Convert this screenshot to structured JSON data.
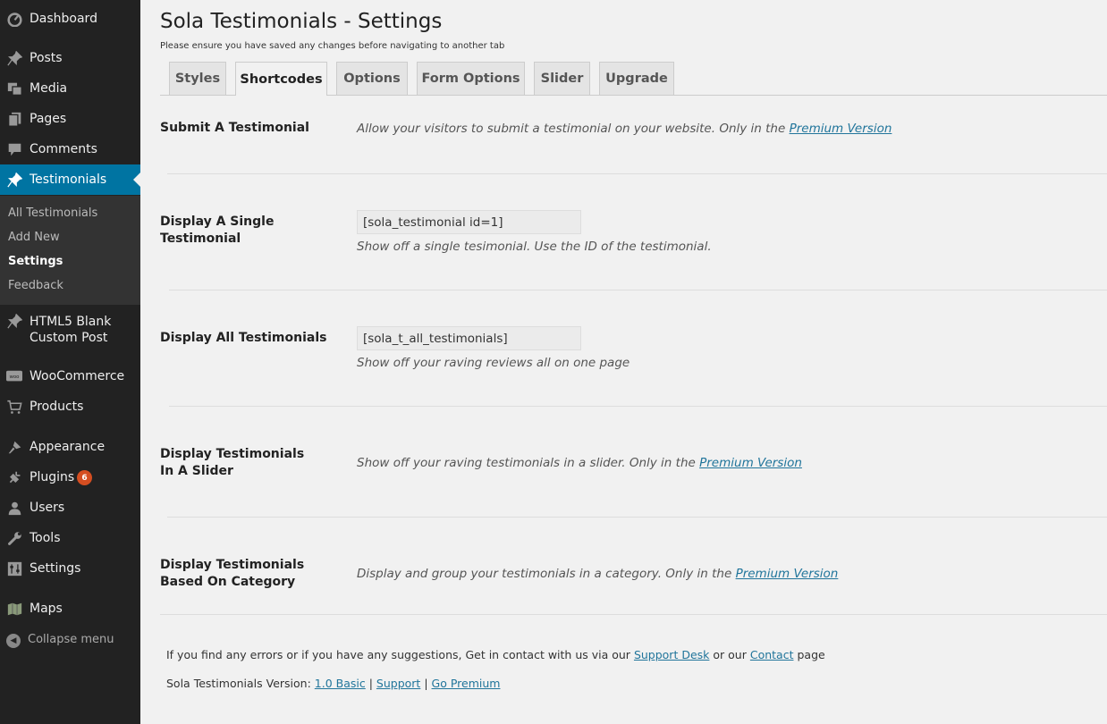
{
  "sidebar": {
    "dashboard": "Dashboard",
    "posts": "Posts",
    "media": "Media",
    "pages": "Pages",
    "comments": "Comments",
    "testimonials": "Testimonials",
    "submenu": [
      "All Testimonials",
      "Add New",
      "Settings",
      "Feedback"
    ],
    "html5_line1": "HTML5 Blank",
    "html5_line2": "Custom Post",
    "woocommerce": "WooCommerce",
    "products": "Products",
    "appearance": "Appearance",
    "plugins": "Plugins",
    "plugins_badge": "6",
    "users": "Users",
    "tools": "Tools",
    "settings": "Settings",
    "maps": "Maps",
    "collapse": "Collapse menu"
  },
  "header": {
    "title": "Sola Testimonials - Settings",
    "notice": "Please ensure you have saved any changes before navigating to another tab"
  },
  "tabs": [
    "Styles",
    "Shortcodes",
    "Options",
    "Form Options",
    "Slider",
    "Upgrade"
  ],
  "active_tab": "Shortcodes",
  "rows": {
    "submit_label": "Submit A Testimonial",
    "submit_desc": "Allow your visitors to submit a testimonial on your website. Only in the",
    "submit_link": "Premium Version",
    "single_label": "Display A Single Testimonial",
    "single_value": "[sola_testimonial id=1]",
    "single_desc": "Show off a single tesimonial. Use the ID of the testimonial.",
    "all_label": "Display All Testimonials",
    "all_value": "[sola_t_all_testimonials]",
    "all_desc": "Show off your raving reviews all on one page",
    "slider_label": "Display Testimonials In A Slider",
    "slider_desc": "Show off your raving testimonials in a slider. Only in the",
    "slider_link": "Premium Version",
    "category_label": "Display Testimonials Based On Category",
    "category_desc": "Display and group your testimonials in a category. Only in the",
    "category_link": "Premium Version"
  },
  "footer": {
    "line1_a": "If you find any errors or if you have any suggestions, Get in contact with us via our",
    "support_desk": "Support Desk",
    "line1_b": "or our",
    "contact": "Contact",
    "line1_c": "page",
    "version_text": "Sola Testimonials Version:",
    "version_link": "1.0 Basic",
    "support": "Support",
    "go_premium": "Go Premium",
    "sep": "|"
  },
  "colors": {
    "sidebar_bg": "#222222",
    "active_menu": "#0074a2",
    "link": "#21759b",
    "badge": "#d54e21"
  }
}
